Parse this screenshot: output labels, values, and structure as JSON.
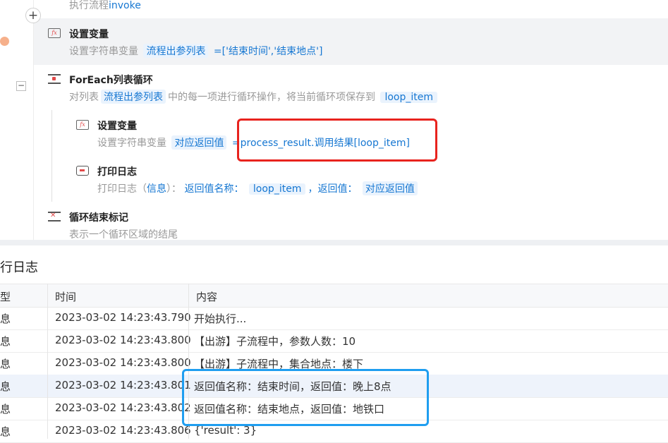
{
  "flow": {
    "top_partial": {
      "prefix": "执行流程",
      "link": "invoke"
    },
    "set_var_1": {
      "title": "设置变量",
      "desc_prefix": "设置字符串变量",
      "var_tag": "流程出参列表",
      "value": "=['结束时间','结束地点']"
    },
    "foreach": {
      "title": "ForEach列表循环",
      "desc_a": "对列表",
      "list_tag": "流程出参列表",
      "desc_b": "中的每一项进行循环操作，将当前循环项保存到",
      "item_tag": "loop_item"
    },
    "set_var_2": {
      "title": "设置变量",
      "desc_prefix": "设置字符串变量",
      "var_tag": "对应返回值",
      "value": "=process_result.调用结果[loop_item]"
    },
    "print_log": {
      "title": "打印日志",
      "desc_a": "打印日志（",
      "level": "信息",
      "desc_b": "）：",
      "name_label": "返回值名称：",
      "name_tag": "loop_item",
      "sep": "，",
      "value_label": "返回值：",
      "value_tag": "对应返回值"
    },
    "loop_end": {
      "title": "循环结束标记",
      "desc": "表示一个循环区域的结尾"
    }
  },
  "log": {
    "title": "行日志",
    "columns": [
      "型",
      "时间",
      "内容"
    ],
    "rows": [
      {
        "type": "息",
        "time": "2023-03-02 14:23:43.790",
        "content": "开始执行..."
      },
      {
        "type": "息",
        "time": "2023-03-02 14:23:43.800",
        "content": "【出游】子流程中，参数人数：10"
      },
      {
        "type": "息",
        "time": "2023-03-02 14:23:43.800",
        "content": "【出游】子流程中，集合地点：楼下"
      },
      {
        "type": "息",
        "time": "2023-03-02 14:23:43.801",
        "content": "返回值名称：结束时间，返回值：晚上8点"
      },
      {
        "type": "息",
        "time": "2023-03-02 14:23:43.802",
        "content": "返回值名称：结束地点，返回值：地铁口"
      },
      {
        "type": "息",
        "time": "2023-03-02 14:23:43.806",
        "content": "{'result': 3}"
      }
    ]
  },
  "colors": {
    "link_blue": "#1677d2",
    "annotation_red": "#e8231e",
    "annotation_blue": "#1f9ef0"
  }
}
